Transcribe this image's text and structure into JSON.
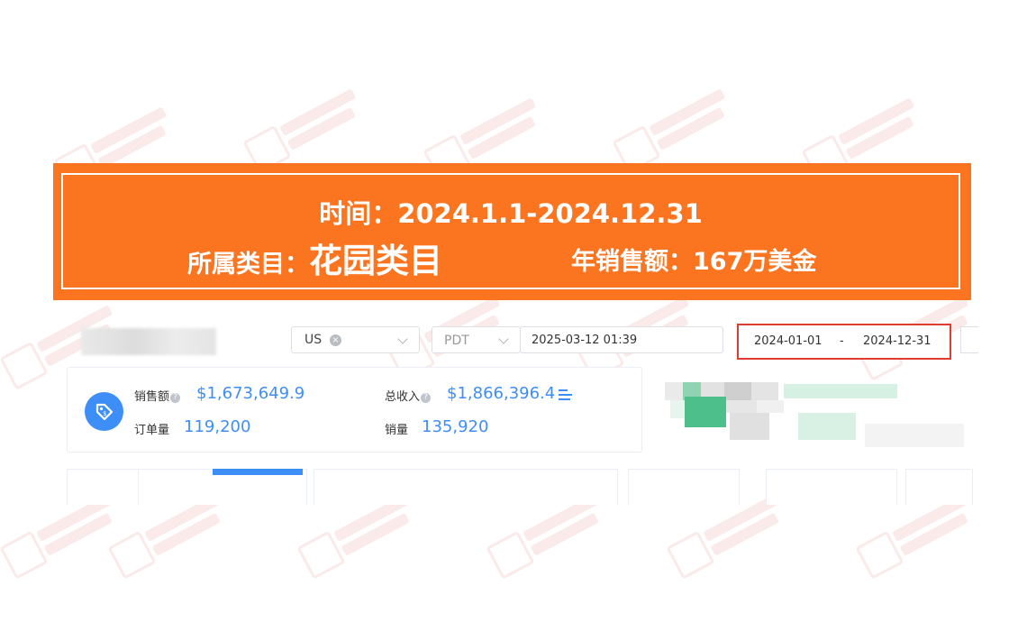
{
  "banner": {
    "time_line": "时间：2024.1.1-2024.12.31",
    "category_label": "所属类目：",
    "category_value": "花园类目",
    "annual_sales": "年销售额：167万美金"
  },
  "filters": {
    "country": "US",
    "timezone": "PDT",
    "current_time": "2025-03-12 01:39",
    "date_start": "2024-01-01",
    "date_separator": "-",
    "date_end": "2024-12-31"
  },
  "stats": {
    "sales_label": "销售额",
    "sales_value": "$1,673,649.9",
    "revenue_label": "总收入",
    "revenue_value": "$1,866,396.4",
    "orders_label": "订单量",
    "orders_value": "119,200",
    "units_label": "销量",
    "units_value": "135,920"
  },
  "colors": {
    "banner_orange": "#fb7420",
    "accent_blue": "#3e8ef7",
    "highlight_red": "#e03c32"
  },
  "icons": {
    "clear": "close-circle-icon",
    "dropdown": "chevron-down-icon",
    "badge": "price-tag-icon",
    "help": "question-circle-icon",
    "menu": "list-menu-icon"
  }
}
